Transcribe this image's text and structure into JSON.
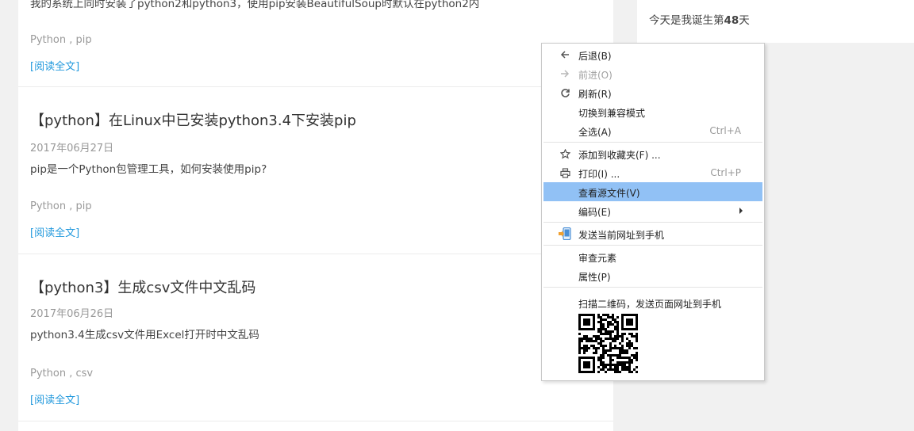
{
  "posts": [
    {
      "title": "",
      "date": "",
      "summary": "我的系统上同时安装了python2和python3，使用pip安装BeautifulSoup时默认在python2内",
      "tags": "Python , pip",
      "read_more": "[阅读全文]"
    },
    {
      "title": "【python】在Linux中已安装python3.4下安装pip",
      "date": "2017年06月27日",
      "summary": "pip是一个Python包管理工具，如何安装使用pip?",
      "tags": "Python , pip",
      "read_more": "[阅读全文]"
    },
    {
      "title": "【python3】生成csv文件中文乱码",
      "date": "2017年06月26日",
      "summary": "python3.4生成csv文件用Excel打开时中文乱码",
      "tags": "Python , csv",
      "read_more": "[阅读全文]"
    }
  ],
  "sidebar": {
    "birthday_prefix": "今天是我诞生第",
    "birthday_days": "48",
    "birthday_suffix": "天"
  },
  "context_menu": {
    "items": [
      {
        "label": "后退(B)",
        "shortcut": "",
        "icon": "arrow-left-icon",
        "disabled": false,
        "highlighted": false,
        "submenu": false
      },
      {
        "label": "前进(O)",
        "shortcut": "",
        "icon": "arrow-right-icon",
        "disabled": true,
        "highlighted": false,
        "submenu": false
      },
      {
        "label": "刷新(R)",
        "shortcut": "",
        "icon": "refresh-icon",
        "disabled": false,
        "highlighted": false,
        "submenu": false
      },
      {
        "label": "切换到兼容模式",
        "shortcut": "",
        "icon": "",
        "disabled": false,
        "highlighted": false,
        "submenu": false
      },
      {
        "label": "全选(A)",
        "shortcut": "Ctrl+A",
        "icon": "",
        "disabled": false,
        "highlighted": false,
        "submenu": false
      },
      {
        "label": "添加到收藏夹(F) ...",
        "shortcut": "",
        "icon": "star-icon",
        "disabled": false,
        "highlighted": false,
        "submenu": false
      },
      {
        "label": "打印(I) ...",
        "shortcut": "Ctrl+P",
        "icon": "printer-icon",
        "disabled": false,
        "highlighted": false,
        "submenu": false
      },
      {
        "label": "查看源文件(V)",
        "shortcut": "",
        "icon": "",
        "disabled": false,
        "highlighted": true,
        "submenu": false
      },
      {
        "label": "编码(E)",
        "shortcut": "",
        "icon": "",
        "disabled": false,
        "highlighted": false,
        "submenu": true
      },
      {
        "label": "发送当前网址到手机",
        "shortcut": "",
        "icon": "send-to-phone-icon",
        "disabled": false,
        "highlighted": false,
        "submenu": false
      },
      {
        "label": "审查元素",
        "shortcut": "",
        "icon": "",
        "disabled": false,
        "highlighted": false,
        "submenu": false
      },
      {
        "label": "属性(P)",
        "shortcut": "",
        "icon": "",
        "disabled": false,
        "highlighted": false,
        "submenu": false
      }
    ],
    "qr_label": "扫描二维码，发送页面网址到手机",
    "highlight_color": "#91c1f5"
  },
  "colors": {
    "link": "#2299dd",
    "page_bg": "#f1f1f1"
  }
}
